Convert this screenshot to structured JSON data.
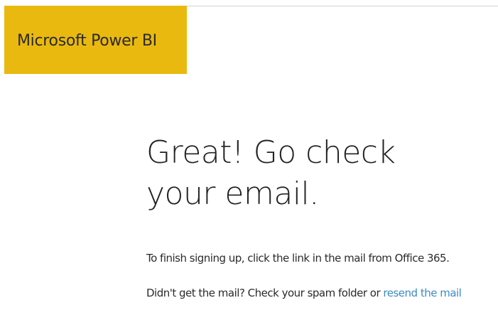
{
  "brand": {
    "name": "Microsoft Power BI",
    "tile_color": "#eab910"
  },
  "main": {
    "heading_line1": "Great! Go check",
    "heading_line2": "your email.",
    "instructions": "To finish signing up, click the link in the mail from Office 365.",
    "resend_prompt": "Didn't get the mail? Check your spam folder or ",
    "resend_link": "resend the mail",
    "link_color": "#3c8cc4"
  }
}
